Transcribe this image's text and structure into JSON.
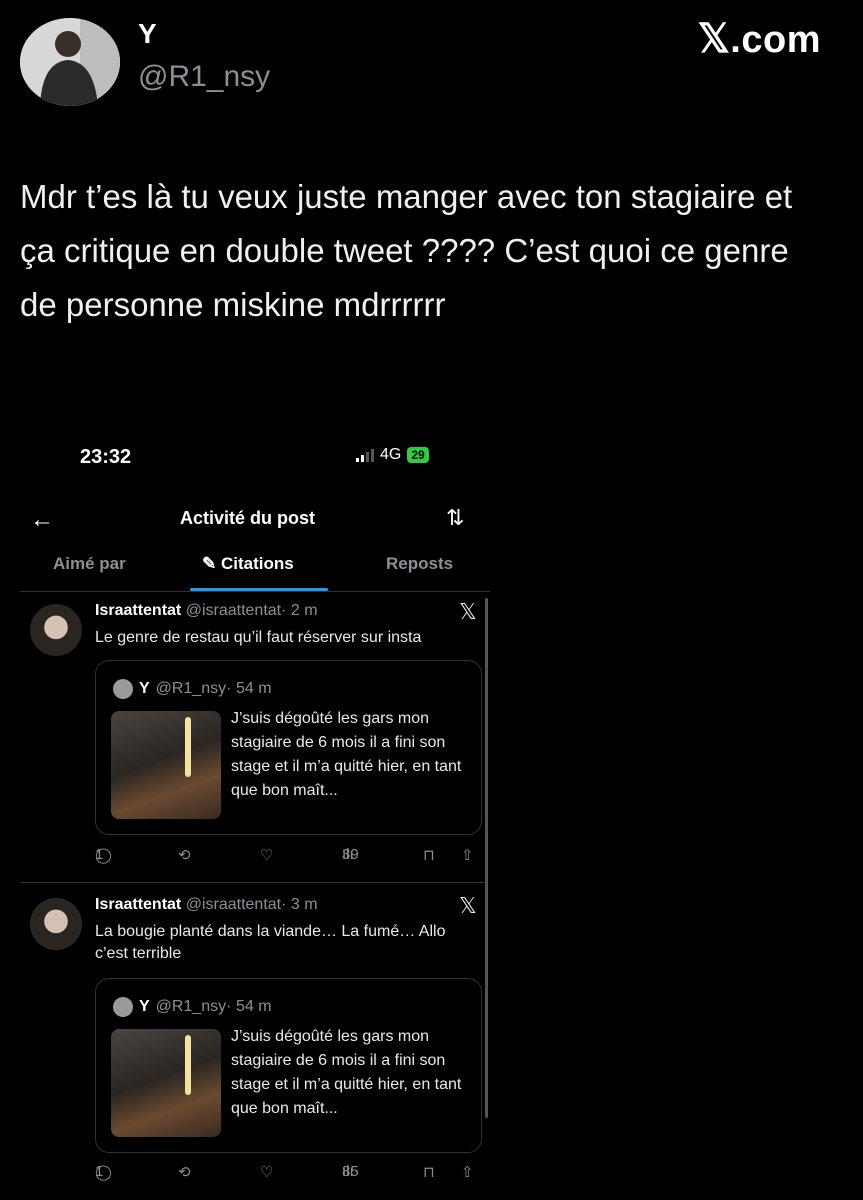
{
  "author": {
    "name": "Y",
    "handle": "@R1_nsy"
  },
  "brand": {
    "mark": "𝕏",
    "suffix": ".com"
  },
  "tweet_text": "Mdr t’es là tu veux juste manger avec ton stagiaire et ça critique en double tweet ???? C’est quoi ce genre de personne miskine mdrrrrrr",
  "screenshot": {
    "status": {
      "time": "23:32",
      "network": "4G",
      "battery": "29"
    },
    "topbar": {
      "back_icon": "←",
      "title": "Activité du post",
      "sort_icon": "⇅"
    },
    "tabs": [
      {
        "label": "Aimé par"
      },
      {
        "label": "Citations",
        "icon": "✎"
      },
      {
        "label": "Reposts"
      }
    ],
    "posts": [
      {
        "name": "Israattentat",
        "handle": "@israattentat",
        "time": "· 2 m",
        "x_icon": "𝕏",
        "text": "Le genre de restau qu’il faut réserver sur insta",
        "quote": {
          "name": "Y",
          "handle": "@R1_nsy",
          "time": "· 54 m",
          "text": "J’suis dégoûté les gars mon stagiaire de 6 mois il a fini son stage et il m’a quitté hier, en tant que bon maît..."
        },
        "actions": {
          "reply_icon": "◯",
          "replies": "1",
          "repost_icon": "⟲",
          "like_icon": "♡",
          "views_icon": "ılı",
          "views": "39",
          "bookmark_icon": "⊓",
          "share_icon": "⇧"
        }
      },
      {
        "name": "Israattentat",
        "handle": "@israattentat",
        "time": "· 3 m",
        "x_icon": "𝕏",
        "text": "La bougie planté dans la viande… La fumé… Allo c’est terrible",
        "quote": {
          "name": "Y",
          "handle": "@R1_nsy",
          "time": "· 54 m",
          "text": "J’suis dégoûté les gars mon stagiaire de 6 mois il a fini son stage et il m’a quitté hier, en tant que bon maît..."
        },
        "actions": {
          "reply_icon": "◯",
          "replies": "1",
          "repost_icon": "⟲",
          "like_icon": "♡",
          "views_icon": "ılı",
          "views": "85",
          "bookmark_icon": "⊓",
          "share_icon": "⇧"
        }
      }
    ]
  }
}
